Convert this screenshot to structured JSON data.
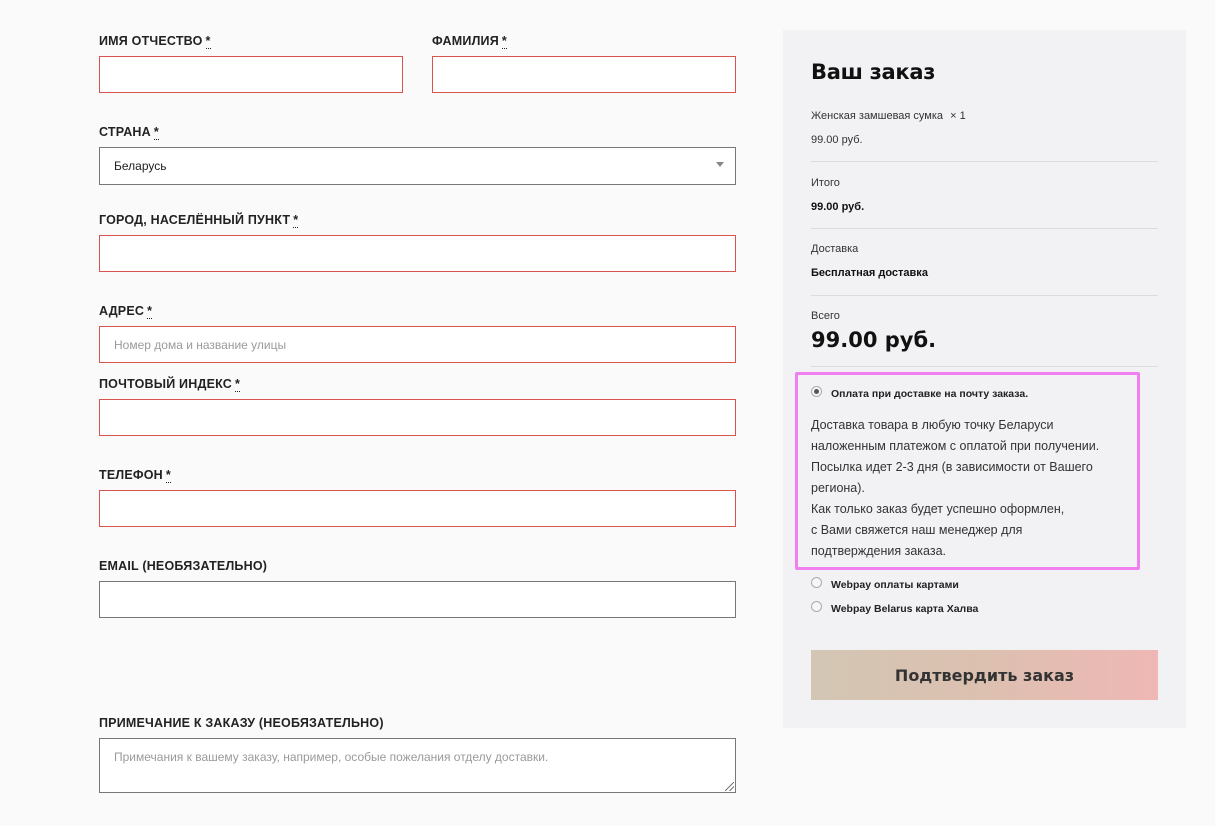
{
  "form": {
    "required_mark": "*",
    "first_name": {
      "label": "Имя Отчество",
      "value": ""
    },
    "last_name": {
      "label": "Фамилия",
      "value": ""
    },
    "country": {
      "label": "Страна",
      "selected": "Беларусь"
    },
    "city": {
      "label": "Город, населённый пункт",
      "value": ""
    },
    "address": {
      "label": "Адрес",
      "placeholder": "Номер дома и название улицы"
    },
    "postcode": {
      "label": "Почтовый индекс",
      "value": ""
    },
    "phone": {
      "label": "Телефон",
      "value": ""
    },
    "email": {
      "label": "Email (необязательно)",
      "value": ""
    },
    "notes": {
      "label": "Примечание к заказу (необязательно)",
      "placeholder": "Примечания к вашему заказу, например, особые пожелания отделу доставки."
    }
  },
  "order": {
    "title": "Ваш заказ",
    "product_name": "Женская замшевая сумка",
    "product_qty": "× 1",
    "product_price": "99.00 руб.",
    "subtotal_label": "Итого",
    "subtotal_value": "99.00 руб.",
    "shipping_label": "Доставка",
    "shipping_value": "Бесплатная доставка",
    "total_label": "Всего",
    "total_value": "99.00 руб.",
    "payment_methods": [
      {
        "label": "Оплата при доставке на почту заказа.",
        "checked": true
      },
      {
        "label": "Webpay оплаты картами",
        "checked": false
      },
      {
        "label": "Webpay Belarus карта Халва",
        "checked": false
      }
    ],
    "payment_description": [
      "Доставка товара в любую точку Беларуси",
      "наложенным платежом с оплатой при получении.",
      "Посылка идет 2-3 дня (в зависимости от Вашего",
      "региона).",
      "Как только заказ будет успешно оформлен,",
      "с Вами свяжется наш менеджер для",
      "подтверждения заказа."
    ],
    "confirm_label": "Подтвердить заказ"
  },
  "colors": {
    "error_border": "#d9534f",
    "panel_bg": "#f2f2f4",
    "highlight": "#f07ff0",
    "button_gradient_start": "#d3c6b4",
    "button_gradient_end": "#efb7b5"
  }
}
